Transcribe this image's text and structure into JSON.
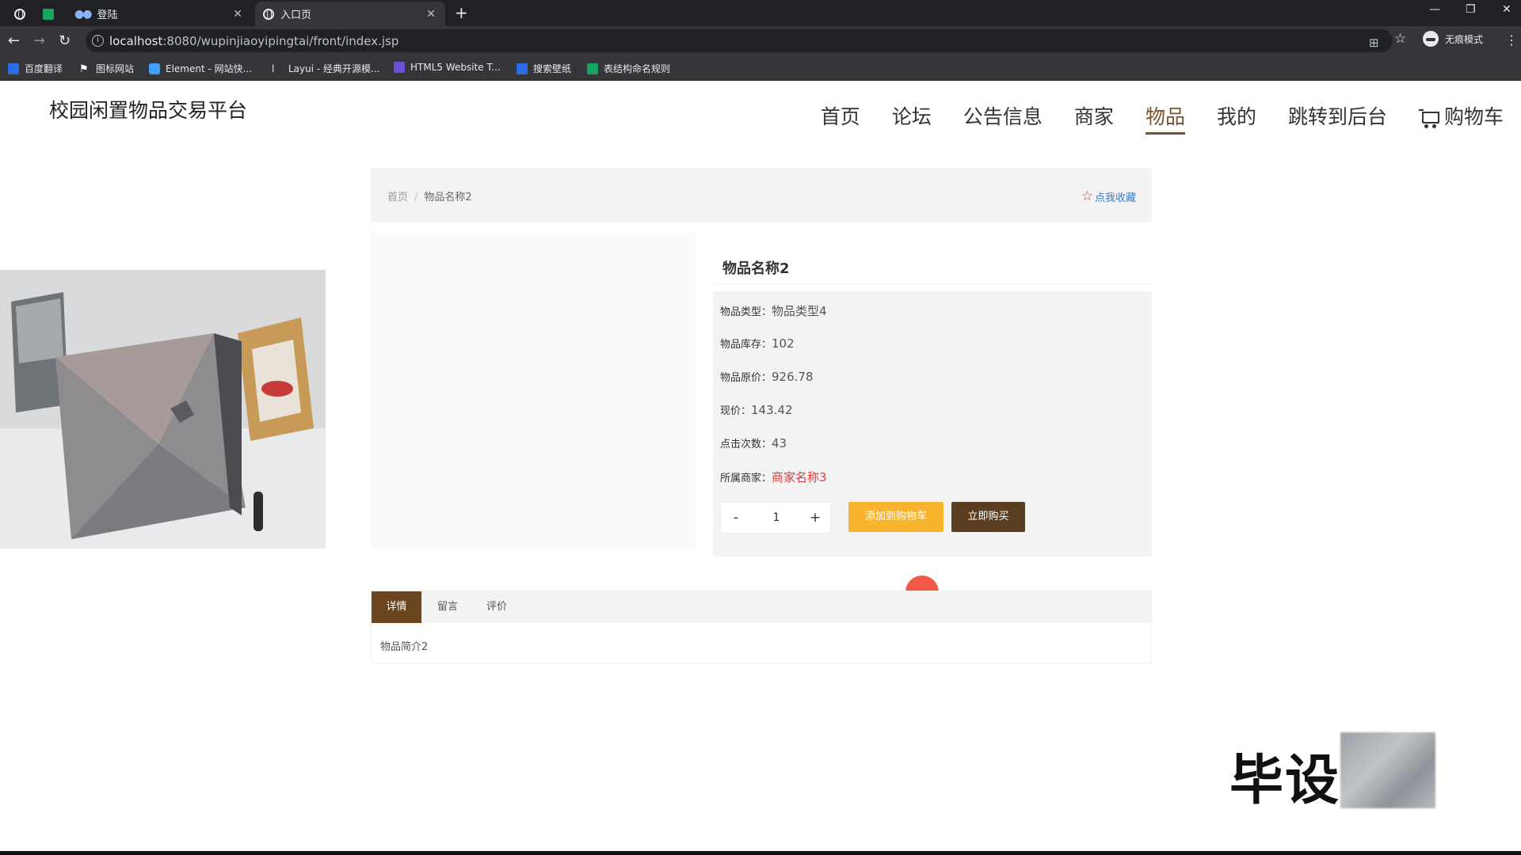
{
  "browser": {
    "tabs": [
      {
        "label": ""
      },
      {
        "label": ""
      },
      {
        "label": "登陆"
      },
      {
        "label": "入口页"
      }
    ],
    "url_host": "localhost",
    "url_rest": ":8080/wupinjiaoyipingtai/front/index.jsp",
    "profile_label": "无痕模式",
    "bookmarks": [
      {
        "label": "百度翻译",
        "color": "#2b6de8"
      },
      {
        "label": "图标网站",
        "color": "#ffffff"
      },
      {
        "label": "Element - 网站快...",
        "color": "#409eff"
      },
      {
        "label": "Layui - 经典开源模...",
        "color": "#e8eaed"
      },
      {
        "label": "HTML5 Website T...",
        "color": "#6b4fd8"
      },
      {
        "label": "搜索壁纸",
        "color": "#2b6de8"
      },
      {
        "label": "表结构命名规则",
        "color": "#1aa260"
      }
    ]
  },
  "site": {
    "title": "校园闲置物品交易平台",
    "nav": [
      {
        "label": "首页",
        "active": false
      },
      {
        "label": "论坛",
        "active": false
      },
      {
        "label": "公告信息",
        "active": false
      },
      {
        "label": "商家",
        "active": false
      },
      {
        "label": "物品",
        "active": true
      },
      {
        "label": "我的",
        "active": false
      },
      {
        "label": "跳转到后台",
        "active": false
      },
      {
        "label": "购物车",
        "active": false
      }
    ]
  },
  "breadcrumb": {
    "home": "首页",
    "separator": "/",
    "current": "物品名称2",
    "favorite": "点我收藏"
  },
  "product": {
    "name": "物品名称2",
    "type_label": "物品类型：",
    "type_value": "物品类型4",
    "stock_label": "物品库存：",
    "stock_value": "102",
    "orig_price_label": "物品原价：",
    "orig_price_value": "926.78",
    "price_label": "现价：",
    "price_value": "143.42",
    "clicks_label": "点击次数：",
    "clicks_value": "43",
    "merchant_label": "所属商家：",
    "merchant_value": "商家名称3"
  },
  "actions": {
    "minus": "-",
    "quantity": "1",
    "plus": "+",
    "add_to_cart": "添加到购物车",
    "buy_now": "立即购买"
  },
  "detail_tabs": {
    "tabs": [
      {
        "label": "详情",
        "active": true
      },
      {
        "label": "留言",
        "active": false
      },
      {
        "label": "评价",
        "active": false
      }
    ],
    "content": "物品简介2"
  },
  "watermark": "毕设"
}
